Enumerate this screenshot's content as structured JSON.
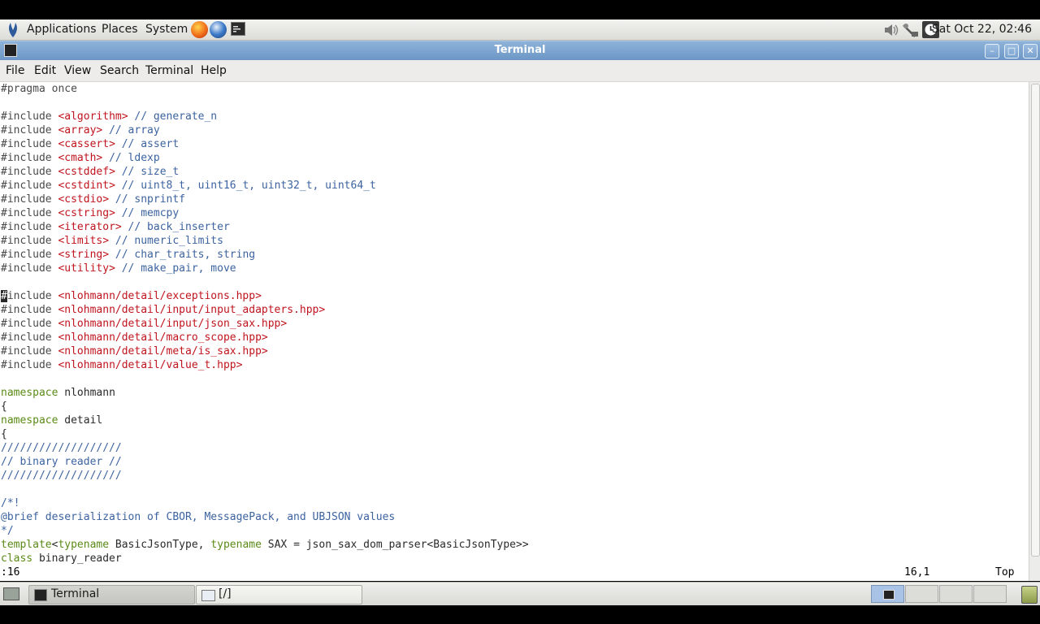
{
  "top_panel": {
    "menus": [
      "Applications",
      "Places",
      "System"
    ],
    "clock": "Sat Oct 22, 02:46"
  },
  "window": {
    "title": "Terminal",
    "menus": [
      "File",
      "Edit",
      "View",
      "Search",
      "Terminal",
      "Help"
    ]
  },
  "editor": {
    "lines": [
      [
        [
          "pp",
          "#pragma once"
        ]
      ],
      [],
      [
        [
          "pp",
          "#include "
        ],
        [
          "inc",
          "<algorithm>"
        ],
        [
          "cm",
          " // generate_n"
        ]
      ],
      [
        [
          "pp",
          "#include "
        ],
        [
          "inc",
          "<array>"
        ],
        [
          "cm",
          " // array"
        ]
      ],
      [
        [
          "pp",
          "#include "
        ],
        [
          "inc",
          "<cassert>"
        ],
        [
          "cm",
          " // assert"
        ]
      ],
      [
        [
          "pp",
          "#include "
        ],
        [
          "inc",
          "<cmath>"
        ],
        [
          "cm",
          " // ldexp"
        ]
      ],
      [
        [
          "pp",
          "#include "
        ],
        [
          "inc",
          "<cstddef>"
        ],
        [
          "cm",
          " // size_t"
        ]
      ],
      [
        [
          "pp",
          "#include "
        ],
        [
          "inc",
          "<cstdint>"
        ],
        [
          "cm",
          " // uint8_t, uint16_t, uint32_t, uint64_t"
        ]
      ],
      [
        [
          "pp",
          "#include "
        ],
        [
          "inc",
          "<cstdio>"
        ],
        [
          "cm",
          " // snprintf"
        ]
      ],
      [
        [
          "pp",
          "#include "
        ],
        [
          "inc",
          "<cstring>"
        ],
        [
          "cm",
          " // memcpy"
        ]
      ],
      [
        [
          "pp",
          "#include "
        ],
        [
          "inc",
          "<iterator>"
        ],
        [
          "cm",
          " // back_inserter"
        ]
      ],
      [
        [
          "pp",
          "#include "
        ],
        [
          "inc",
          "<limits>"
        ],
        [
          "cm",
          " // numeric_limits"
        ]
      ],
      [
        [
          "pp",
          "#include "
        ],
        [
          "inc",
          "<string>"
        ],
        [
          "cm",
          " // char_traits, string"
        ]
      ],
      [
        [
          "pp",
          "#include "
        ],
        [
          "inc",
          "<utility>"
        ],
        [
          "cm",
          " // make_pair, move"
        ]
      ],
      [],
      [
        [
          "cursor",
          "#"
        ],
        [
          "pp",
          "include "
        ],
        [
          "inc",
          "<nlohmann/detail/exceptions.hpp>"
        ]
      ],
      [
        [
          "pp",
          "#include "
        ],
        [
          "inc",
          "<nlohmann/detail/input/input_adapters.hpp>"
        ]
      ],
      [
        [
          "pp",
          "#include "
        ],
        [
          "inc",
          "<nlohmann/detail/input/json_sax.hpp>"
        ]
      ],
      [
        [
          "pp",
          "#include "
        ],
        [
          "inc",
          "<nlohmann/detail/macro_scope.hpp>"
        ]
      ],
      [
        [
          "pp",
          "#include "
        ],
        [
          "inc",
          "<nlohmann/detail/meta/is_sax.hpp>"
        ]
      ],
      [
        [
          "pp",
          "#include "
        ],
        [
          "inc",
          "<nlohmann/detail/value_t.hpp>"
        ]
      ],
      [],
      [
        [
          "kw",
          "namespace"
        ],
        [
          "tx",
          " nlohmann"
        ]
      ],
      [
        [
          "tx",
          "{"
        ]
      ],
      [
        [
          "kw",
          "namespace"
        ],
        [
          "tx",
          " detail"
        ]
      ],
      [
        [
          "tx",
          "{"
        ]
      ],
      [
        [
          "cm",
          "///////////////////"
        ]
      ],
      [
        [
          "cm",
          "// binary reader //"
        ]
      ],
      [
        [
          "cm",
          "///////////////////"
        ]
      ],
      [],
      [
        [
          "cm",
          "/*!"
        ]
      ],
      [
        [
          "cm",
          "@brief deserialization of CBOR, MessagePack, and UBJSON values"
        ]
      ],
      [
        [
          "cm",
          "*/"
        ]
      ],
      [
        [
          "kw",
          "template"
        ],
        [
          "tx",
          "<"
        ],
        [
          "kw",
          "typename"
        ],
        [
          "tx",
          " BasicJsonType, "
        ],
        [
          "kw",
          "typename"
        ],
        [
          "tx",
          " SAX = json_sax_dom_parser<BasicJsonType>>"
        ]
      ],
      [
        [
          "kw",
          "class"
        ],
        [
          "tx",
          " binary_reader"
        ]
      ]
    ]
  },
  "status": {
    "command": ":16",
    "position": "16,1",
    "scroll": "Top"
  },
  "taskbar": {
    "items": [
      "Terminal",
      "[/]"
    ]
  }
}
